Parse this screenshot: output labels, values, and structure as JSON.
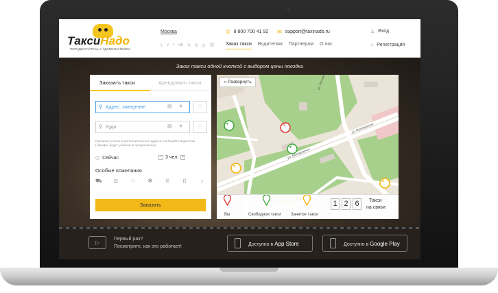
{
  "header": {
    "logo": {
      "part1": "Такси",
      "part2": "Надо",
      "tagline": "ПЕРЕДВИГАЙТЕСЬ С УДОВОЛЬСТВИЕМ"
    },
    "city": "Москва",
    "socials": [
      "twitter-icon",
      "vk-icon",
      "facebook-icon",
      "odnoklassniki-icon",
      "livejournal-icon",
      "google-plus-icon",
      "instagram-icon",
      "mailru-icon"
    ],
    "phone": "8 800 700 41 92",
    "email": "support@taxinado.ru",
    "nav": [
      {
        "label": "Заказ такси"
      },
      {
        "label": "Водителям"
      },
      {
        "label": "Партнерам"
      },
      {
        "label": "О нас"
      }
    ],
    "login": "Вход",
    "register": "Регистрация"
  },
  "hero": {
    "title": "Заказ такси одной кнопкой с выбором цены поездки"
  },
  "order_form": {
    "tabs": [
      {
        "label": "Заказать такси"
      },
      {
        "label": "Арендовать такси"
      }
    ],
    "from_placeholder": "Адрес, заведение",
    "to_placeholder": "Куда",
    "hint": "Промежуточные и дополнительные адреса сообщайте водителю (тарифы будут указаны в предложении)",
    "time": "Сейчас",
    "passengers": "3 чел.",
    "wishes_title": "Особые пожелания",
    "wishes_icons": [
      "car-class-icon",
      "child-seat-icon",
      "pet-icon",
      "air-conditioner-icon",
      "baby-seat-icon",
      "luggage-icon",
      "music-icon"
    ],
    "submit_label": "Заказать"
  },
  "map": {
    "expand_label": "Развернуть",
    "streets": [
      "ул. Москворечье",
      "ул. Москворечье",
      "ул. Лётчика"
    ],
    "legend": [
      {
        "label": "Вы",
        "color": "#d9342b"
      },
      {
        "label": "Свободное такси",
        "color": "#3ca53a"
      },
      {
        "label": "Занятое такси",
        "color": "#f0b400"
      }
    ],
    "counter": {
      "digits": [
        "1",
        "2",
        "6"
      ],
      "label1": "Такси",
      "label2": "на связи"
    }
  },
  "footer": {
    "first_time": "Первый раз?",
    "how_it_works": "Посмотрите, как это работает!",
    "appstore": {
      "prefix": "Доступно в",
      "store": "App Store"
    },
    "googleplay": {
      "prefix": "Доступно в",
      "store": "Google Play"
    }
  }
}
